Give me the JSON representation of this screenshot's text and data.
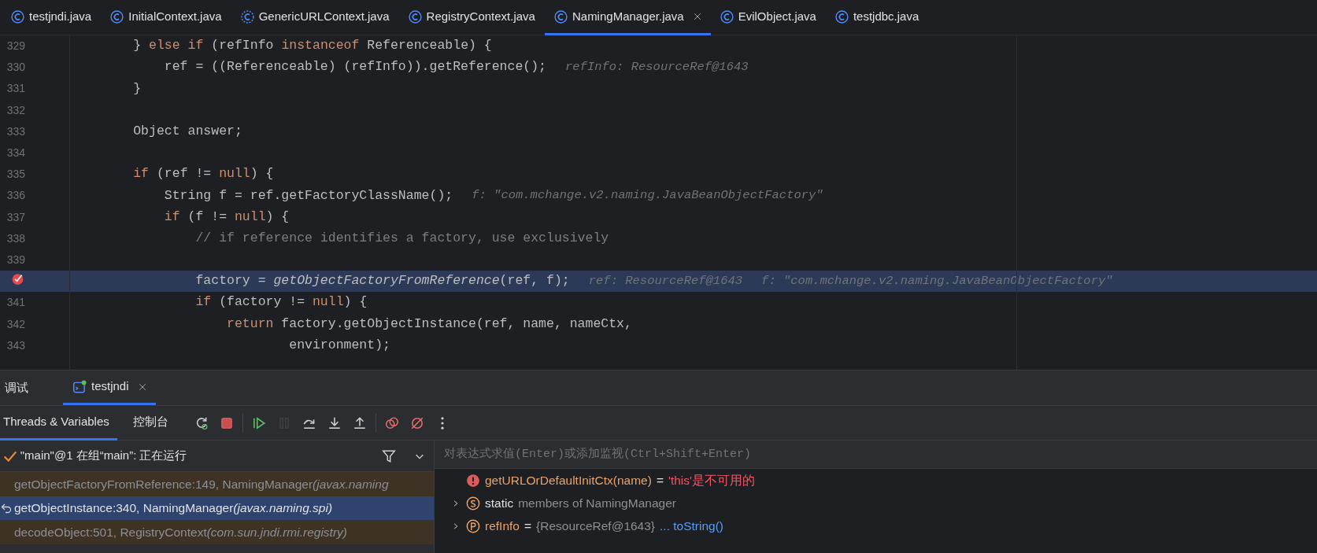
{
  "editor_tabs": [
    {
      "label": "testjndi.java",
      "kind": "class",
      "selected": false
    },
    {
      "label": "InitialContext.java",
      "kind": "class",
      "selected": false
    },
    {
      "label": "GenericURLContext.java",
      "kind": "abstract",
      "selected": false
    },
    {
      "label": "RegistryContext.java",
      "kind": "class",
      "selected": false
    },
    {
      "label": "NamingManager.java",
      "kind": "class",
      "selected": true
    },
    {
      "label": "EvilObject.java",
      "kind": "class",
      "selected": false
    },
    {
      "label": "testjdbc.java",
      "kind": "class",
      "selected": false
    }
  ],
  "code_lines": [
    {
      "number": "329",
      "breakpoint": false,
      "current": false,
      "segments": [
        {
          "kind": "plain",
          "text": "        } "
        },
        {
          "kind": "keyword",
          "text": "else if"
        },
        {
          "kind": "plain",
          "text": " (refInfo "
        },
        {
          "kind": "keyword",
          "text": "instanceof"
        },
        {
          "kind": "plain",
          "text": " Referenceable) {"
        }
      ]
    },
    {
      "number": "330",
      "breakpoint": false,
      "current": false,
      "segments": [
        {
          "kind": "plain",
          "text": "            ref = ((Referenceable) (refInfo)).getReference();"
        },
        {
          "kind": "hint",
          "text": "refInfo: ResourceRef@1643"
        }
      ]
    },
    {
      "number": "331",
      "breakpoint": false,
      "current": false,
      "segments": [
        {
          "kind": "plain",
          "text": "        }"
        }
      ]
    },
    {
      "number": "332",
      "breakpoint": false,
      "current": false
    },
    {
      "number": "333",
      "breakpoint": false,
      "current": false,
      "segments": [
        {
          "kind": "plain",
          "text": "        Object answer;"
        }
      ]
    },
    {
      "number": "334",
      "breakpoint": false,
      "current": false
    },
    {
      "number": "335",
      "breakpoint": false,
      "current": false,
      "segments": [
        {
          "kind": "keyword",
          "text": "        if"
        },
        {
          "kind": "plain",
          "text": " (ref != "
        },
        {
          "kind": "keyword",
          "text": "null"
        },
        {
          "kind": "plain",
          "text": ") {"
        }
      ]
    },
    {
      "number": "336",
      "breakpoint": false,
      "current": false,
      "segments": [
        {
          "kind": "plain",
          "text": "            String f = ref.getFactoryClassName();"
        },
        {
          "kind": "hint",
          "text": "f: \"com.mchange.v2.naming.JavaBeanObjectFactory\""
        }
      ]
    },
    {
      "number": "337",
      "breakpoint": false,
      "current": false,
      "segments": [
        {
          "kind": "keyword",
          "text": "            if"
        },
        {
          "kind": "plain",
          "text": " (f != "
        },
        {
          "kind": "keyword",
          "text": "null"
        },
        {
          "kind": "plain",
          "text": ") {"
        }
      ]
    },
    {
      "number": "338",
      "breakpoint": false,
      "current": false,
      "segments": [
        {
          "kind": "comment",
          "text": "                // if reference identifies a factory, use exclusively"
        }
      ]
    },
    {
      "number": "339",
      "breakpoint": false,
      "current": false
    },
    {
      "breakpoint": true,
      "current": true,
      "segments": [
        {
          "kind": "plain",
          "text": "                factory = "
        },
        {
          "kind": "static",
          "text": "getObjectFactoryFromReference"
        },
        {
          "kind": "plain",
          "text": "(ref, f);"
        },
        {
          "kind": "hint",
          "text": "ref: ResourceRef@1643"
        },
        {
          "kind": "hint",
          "text": "f: \"com.mchange.v2.naming.JavaBeanObjectFactory\""
        }
      ]
    },
    {
      "number": "341",
      "breakpoint": false,
      "current": false,
      "segments": [
        {
          "kind": "keyword",
          "text": "                if"
        },
        {
          "kind": "plain",
          "text": " (factory != "
        },
        {
          "kind": "keyword",
          "text": "null"
        },
        {
          "kind": "plain",
          "text": ") {"
        }
      ]
    },
    {
      "number": "342",
      "breakpoint": false,
      "current": false,
      "segments": [
        {
          "kind": "keyword",
          "text": "                    return"
        },
        {
          "kind": "plain",
          "text": " factory.getObjectInstance(ref, name, nameCtx,"
        }
      ]
    },
    {
      "number": "343",
      "breakpoint": false,
      "current": false,
      "segments": [
        {
          "kind": "plain",
          "text": "                            environment);"
        }
      ]
    }
  ],
  "debug_panel": {
    "title": "调试",
    "session_tabs": [
      {
        "label": "testjndi",
        "selected": true
      }
    ],
    "view_tabs": [
      {
        "label": "Threads & Variables",
        "selected": true
      },
      {
        "label": "控制台",
        "selected": false
      }
    ],
    "toolbar": [
      {
        "kind": "rerun",
        "disabled": false
      },
      {
        "kind": "stop",
        "disabled": false
      },
      {
        "kind": "sep"
      },
      {
        "kind": "resume",
        "disabled": false
      },
      {
        "kind": "pause",
        "disabled": true
      },
      {
        "kind": "step-over",
        "disabled": false
      },
      {
        "kind": "step-into",
        "disabled": false
      },
      {
        "kind": "step-out",
        "disabled": false
      },
      {
        "kind": "sep"
      },
      {
        "kind": "breakpoints",
        "disabled": false
      },
      {
        "kind": "mute",
        "disabled": false
      },
      {
        "kind": "more",
        "disabled": false
      }
    ],
    "thread": "\"main\"@1 在组“main”: 正在运行",
    "frames": [
      {
        "method": "getObjectFactoryFromReference:149, NamingManager",
        "package": "(javax.naming",
        "selected": false
      },
      {
        "method": "getObjectInstance:340, NamingManager",
        "package": "(javax.naming.spi)",
        "selected": true
      },
      {
        "method": "decodeObject:501, RegistryContext",
        "package": "(com.sun.jndi.rmi.registry)",
        "selected": false
      }
    ],
    "evaluate": {
      "placeholder": "对表达式求值(Enter)或添加监视(Ctrl+Shift+Enter)"
    },
    "variables": [
      {
        "kind": "error",
        "expandable": false,
        "name": "getURLOrDefaultInitCtx(name)",
        "equals": "=",
        "value": "'this'是不可用的"
      },
      {
        "kind": "static",
        "expandable": true,
        "name": "static",
        "value": "members of NamingManager"
      },
      {
        "kind": "field",
        "expandable": true,
        "name": "refInfo",
        "equals": "=",
        "value": "{ResourceRef@1643}",
        "link": "... toString()"
      }
    ]
  }
}
